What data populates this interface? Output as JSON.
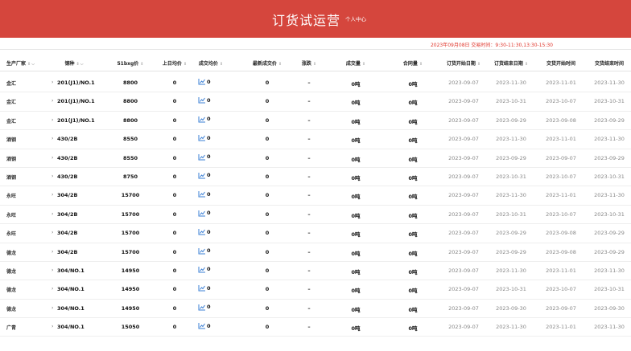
{
  "header": {
    "title": "订货试运营",
    "user_center": "个人中心",
    "brand_color": "#d5463d"
  },
  "session": {
    "text": "2023年09月08日 交易时间：9:30-11:30,13:30-15:30",
    "color": "#e0342a"
  },
  "table": {
    "columns": [
      {
        "label": "生产厂家",
        "sort": true,
        "filter": true
      },
      {
        "label": "钢种",
        "sort": true,
        "filter": true
      },
      {
        "label": "51bxg价",
        "sort": true
      },
      {
        "label": "上日均价",
        "sort": true
      },
      {
        "label": "成交均价",
        "sort": true
      },
      {
        "label": "最新成交价",
        "sort": true
      },
      {
        "label": "涨跌",
        "sort": true
      },
      {
        "label": "成交量",
        "sort": true
      },
      {
        "label": "合同量",
        "sort": true
      },
      {
        "label": "订货开始日期",
        "sort": true
      },
      {
        "label": "订货结束日期",
        "sort": true
      },
      {
        "label": "交货开始时间",
        "sort": false
      },
      {
        "label": "交货结束时间",
        "sort": false
      }
    ],
    "trend_icon": "line-chart-icon",
    "rows": [
      {
        "mfr": "金汇",
        "spec": "201(J1)/NO.1",
        "price": "8800",
        "prev_avg": "0",
        "deal_avg": "0",
        "latest": "0",
        "change": "–",
        "volume": "0吨",
        "contract": "0吨",
        "order_start": "2023-09-07",
        "order_end": "2023-11-30",
        "delivery_start": "2023-11-01",
        "delivery_end": "2023-11-30"
      },
      {
        "mfr": "金汇",
        "spec": "201(J1)/NO.1",
        "price": "8800",
        "prev_avg": "0",
        "deal_avg": "0",
        "latest": "0",
        "change": "–",
        "volume": "0吨",
        "contract": "0吨",
        "order_start": "2023-09-07",
        "order_end": "2023-10-31",
        "delivery_start": "2023-10-07",
        "delivery_end": "2023-10-31"
      },
      {
        "mfr": "金汇",
        "spec": "201(J1)/NO.1",
        "price": "8800",
        "prev_avg": "0",
        "deal_avg": "0",
        "latest": "0",
        "change": "–",
        "volume": "0吨",
        "contract": "0吨",
        "order_start": "2023-09-07",
        "order_end": "2023-09-29",
        "delivery_start": "2023-09-08",
        "delivery_end": "2023-09-29"
      },
      {
        "mfr": "酒钢",
        "spec": "430/2B",
        "price": "8550",
        "prev_avg": "0",
        "deal_avg": "0",
        "latest": "0",
        "change": "–",
        "volume": "0吨",
        "contract": "0吨",
        "order_start": "2023-09-07",
        "order_end": "2023-11-30",
        "delivery_start": "2023-11-01",
        "delivery_end": "2023-11-30"
      },
      {
        "mfr": "酒钢",
        "spec": "430/2B",
        "price": "8550",
        "prev_avg": "0",
        "deal_avg": "0",
        "latest": "0",
        "change": "–",
        "volume": "0吨",
        "contract": "0吨",
        "order_start": "2023-09-07",
        "order_end": "2023-09-29",
        "delivery_start": "2023-09-07",
        "delivery_end": "2023-09-29"
      },
      {
        "mfr": "酒钢",
        "spec": "430/2B",
        "price": "8750",
        "prev_avg": "0",
        "deal_avg": "0",
        "latest": "0",
        "change": "–",
        "volume": "0吨",
        "contract": "0吨",
        "order_start": "2023-09-07",
        "order_end": "2023-10-31",
        "delivery_start": "2023-10-07",
        "delivery_end": "2023-10-31"
      },
      {
        "mfr": "永旺",
        "spec": "304/2B",
        "price": "15700",
        "prev_avg": "0",
        "deal_avg": "0",
        "latest": "0",
        "change": "–",
        "volume": "0吨",
        "contract": "0吨",
        "order_start": "2023-09-07",
        "order_end": "2023-11-30",
        "delivery_start": "2023-11-01",
        "delivery_end": "2023-11-30"
      },
      {
        "mfr": "永旺",
        "spec": "304/2B",
        "price": "15700",
        "prev_avg": "0",
        "deal_avg": "0",
        "latest": "0",
        "change": "–",
        "volume": "0吨",
        "contract": "0吨",
        "order_start": "2023-09-07",
        "order_end": "2023-10-31",
        "delivery_start": "2023-10-07",
        "delivery_end": "2023-10-31"
      },
      {
        "mfr": "永旺",
        "spec": "304/2B",
        "price": "15700",
        "prev_avg": "0",
        "deal_avg": "0",
        "latest": "0",
        "change": "–",
        "volume": "0吨",
        "contract": "0吨",
        "order_start": "2023-09-07",
        "order_end": "2023-09-29",
        "delivery_start": "2023-09-08",
        "delivery_end": "2023-09-29"
      },
      {
        "mfr": "德龙",
        "spec": "304/2B",
        "price": "15700",
        "prev_avg": "0",
        "deal_avg": "0",
        "latest": "0",
        "change": "–",
        "volume": "0吨",
        "contract": "0吨",
        "order_start": "2023-09-07",
        "order_end": "2023-09-29",
        "delivery_start": "2023-09-08",
        "delivery_end": "2023-09-29"
      },
      {
        "mfr": "德龙",
        "spec": "304/NO.1",
        "price": "14950",
        "prev_avg": "0",
        "deal_avg": "0",
        "latest": "0",
        "change": "–",
        "volume": "0吨",
        "contract": "0吨",
        "order_start": "2023-09-07",
        "order_end": "2023-11-30",
        "delivery_start": "2023-11-01",
        "delivery_end": "2023-11-30"
      },
      {
        "mfr": "德龙",
        "spec": "304/NO.1",
        "price": "14950",
        "prev_avg": "0",
        "deal_avg": "0",
        "latest": "0",
        "change": "–",
        "volume": "0吨",
        "contract": "0吨",
        "order_start": "2023-09-07",
        "order_end": "2023-10-31",
        "delivery_start": "2023-10-07",
        "delivery_end": "2023-10-31"
      },
      {
        "mfr": "德龙",
        "spec": "304/NO.1",
        "price": "14950",
        "prev_avg": "0",
        "deal_avg": "0",
        "latest": "0",
        "change": "–",
        "volume": "0吨",
        "contract": "0吨",
        "order_start": "2023-09-07",
        "order_end": "2023-09-30",
        "delivery_start": "2023-09-07",
        "delivery_end": "2023-09-30"
      },
      {
        "mfr": "广青",
        "spec": "304/NO.1",
        "price": "15050",
        "prev_avg": "0",
        "deal_avg": "0",
        "latest": "0",
        "change": "–",
        "volume": "0吨",
        "contract": "0吨",
        "order_start": "2023-09-07",
        "order_end": "2023-11-30",
        "delivery_start": "2023-11-01",
        "delivery_end": "2023-11-30"
      }
    ]
  }
}
